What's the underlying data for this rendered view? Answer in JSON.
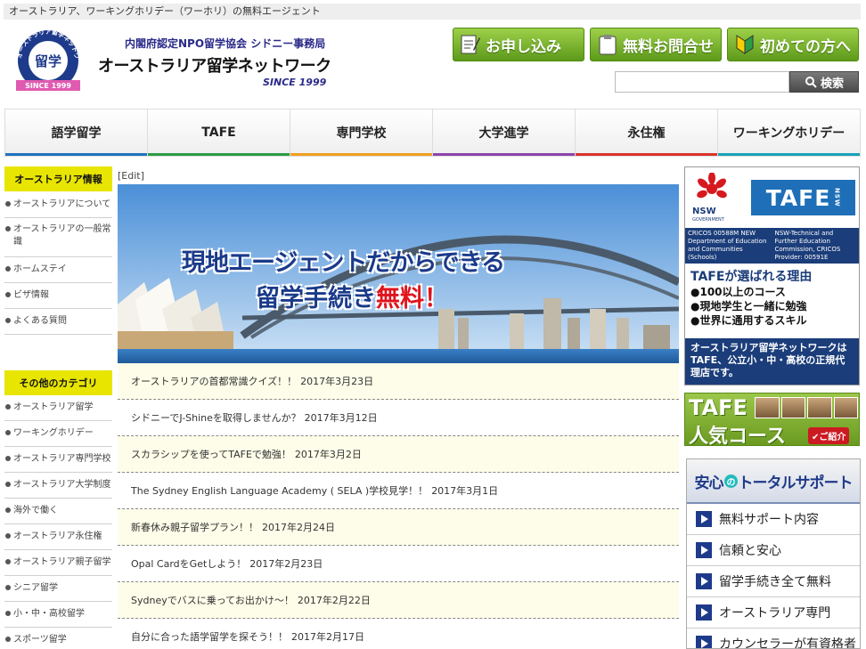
{
  "topbar": {
    "text": "オーストラリア、ワーキングホリデー（ワーホリ）の無料エージェント"
  },
  "header": {
    "logo": {
      "arc_text": "オーストラリア留学ネットワーク",
      "center": "留学",
      "ribbon": "SINCE 1999"
    },
    "org_line1": "内閣府認定NPO留学協会 シドニー事務局",
    "org_name": "オーストラリア留学ネットワーク",
    "since": "SINCE 1999",
    "buttons": [
      {
        "label": "お申し込み",
        "icon": "pencil-note-icon"
      },
      {
        "label": "無料お問合せ",
        "icon": "clipboard-icon"
      },
      {
        "label": "初めての方へ",
        "icon": "beginner-mark-icon"
      }
    ],
    "search": {
      "placeholder": "",
      "button_label": "検索",
      "icon": "magnifier-icon"
    }
  },
  "nav": [
    {
      "label": "語学留学",
      "color": "#1e73be"
    },
    {
      "label": "TAFE",
      "color": "#2a9d45"
    },
    {
      "label": "専門学校",
      "color": "#f0a020"
    },
    {
      "label": "大学進学",
      "color": "#8e44ad"
    },
    {
      "label": "永住権",
      "color": "#d9342b"
    },
    {
      "label": "ワーキングホリデー",
      "color": "#17a2b8"
    }
  ],
  "sidebar": {
    "section1": {
      "title": "オーストラリア情報",
      "items": [
        "オーストラリアについて",
        "オーストラリアの一般常識",
        "ホームステイ",
        "ビザ情報",
        "よくある質問"
      ]
    },
    "section2": {
      "title": "その他のカテゴリ",
      "items": [
        "オーストラリア留学",
        "ワーキングホリデー",
        "オーストラリア専門学校",
        "オーストラリア大学制度",
        "海外で働く",
        "オーストラリア永住権",
        "オーストラリア親子留学",
        "シニア留学",
        "小・中・高校留学",
        "スポーツ留学"
      ]
    }
  },
  "main": {
    "edit_link": "[Edit]",
    "hero": {
      "line1": "現地エージェントだからできる",
      "line2_a": "留学手続き",
      "line2_b": "無料",
      "line2_c": "！"
    },
    "news": [
      {
        "title": "オーストラリアの首都常識クイズ！！",
        "date": "2017年3月23日"
      },
      {
        "title": "シドニーでJ-Shineを取得しませんか？",
        "date": "2017年3月12日"
      },
      {
        "title": "スカラシップを使ってTAFEで勉強！",
        "date": "2017年3月2日"
      },
      {
        "title": "The Sydney English Language Academy ( SELA )学校見学！！",
        "date": "2017年3月1日"
      },
      {
        "title": "新春休み親子留学プラン！！",
        "date": "2017年2月24日"
      },
      {
        "title": "Opal CardをGetしよう！",
        "date": "2017年2月23日"
      },
      {
        "title": "Sydneyでバスに乗ってお出かけ～！",
        "date": "2017年2月22日"
      },
      {
        "title": "自分に合った語学留学を探そう！！",
        "date": "2017年2月17日"
      }
    ]
  },
  "right": {
    "tafe_banner": {
      "nsw": "NSW",
      "nsw_sub": "GOVERNMENT",
      "tafe": "TAFE",
      "tafe_side": "NSW",
      "cricos_left": "CRICOS 00588M NEW Department of Education and Communities (Schools)",
      "cricos_right": "NSW-Technical and Further Education Commission, CRICOS Provider: 00591E",
      "reason_title": "TAFEが選ばれる理由",
      "points": [
        "●100以上のコース",
        "●現地学生と一緒に勉強",
        "●世界に通用するスキル"
      ],
      "footer": "オーストラリア留学ネットワークはTAFE、公立小・中・高校の正規代理店です。"
    },
    "tafe_popular": {
      "l1": "TAFE",
      "l2": "人気コース",
      "badge": "ご紹介"
    },
    "support": {
      "title_a": "安心",
      "title_no": "の",
      "title_b": "トータルサポート",
      "items": [
        "無料サポート内容",
        "信頼と安心",
        "留学手続き全て無料",
        "オーストラリア専門",
        "カウンセラーが有資格者"
      ]
    }
  }
}
